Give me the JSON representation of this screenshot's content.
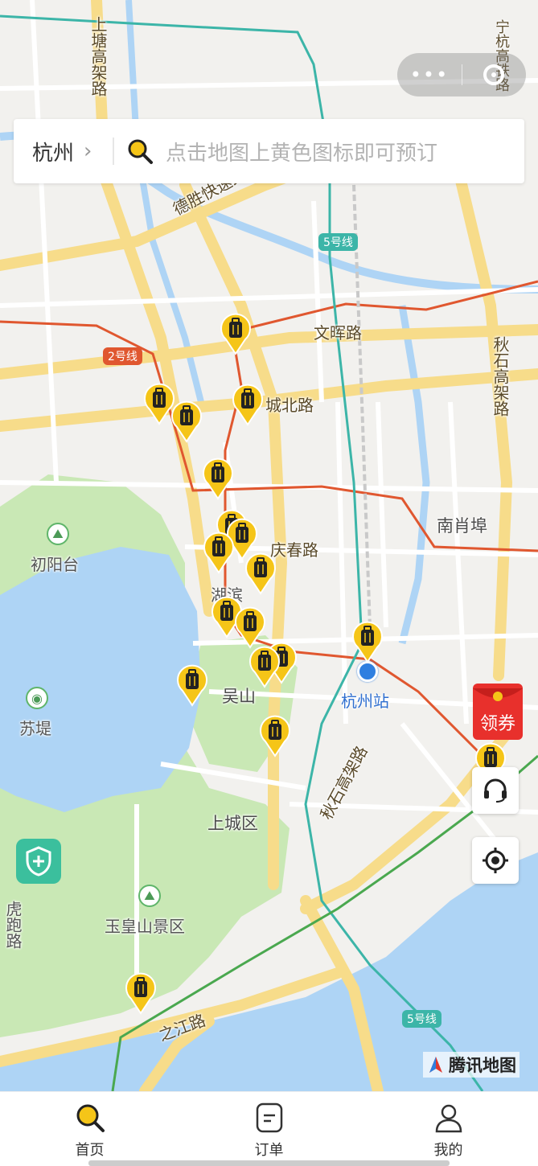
{
  "search_bar": {
    "city": "杭州",
    "chevron_icon": "chevron-right-icon",
    "search_icon": "search-icon",
    "placeholder": "点击地图上黄色图标即可预订"
  },
  "capsule": {
    "more_icon": "more-dots-icon",
    "close_icon": "target-close-icon"
  },
  "map": {
    "roads": {
      "r1": "上塘高架路",
      "r2": "宁杭高铁路",
      "r3": "德胜快速路",
      "r4": "文晖路",
      "r5": "城北路",
      "r6": "秋石高架路",
      "r7": "庆春路",
      "r8": "秋石高架路",
      "r9": "之江路"
    },
    "metro": {
      "m2": "2号线",
      "m5a": "5号线",
      "m5b": "5号线"
    },
    "places": {
      "p1": "南肖埠",
      "p2": "初阳台",
      "p3": "苏堤",
      "p4": "吴山",
      "p5": "杭州站",
      "p6": "上城区",
      "p7": "玉皇山景区",
      "p8": "虎跑路",
      "p9": "湖滨"
    },
    "pin_icon": "luggage-pin-icon",
    "attribution": "腾讯地图"
  },
  "floating": {
    "coupon_label": "领券",
    "service_icon": "headset-icon",
    "locate_icon": "locate-icon",
    "shield_icon": "shield-plus-icon"
  },
  "tabs": [
    {
      "label": "首页",
      "icon": "search-icon",
      "active": true
    },
    {
      "label": "订单",
      "icon": "order-icon",
      "active": false
    },
    {
      "label": "我的",
      "icon": "user-icon",
      "active": false
    }
  ],
  "colors": {
    "accent": "#f5c518",
    "metro2": "#e0572f",
    "metro5": "#3cb5a8",
    "water": "#aed4f5",
    "park": "#c9e8b5"
  }
}
